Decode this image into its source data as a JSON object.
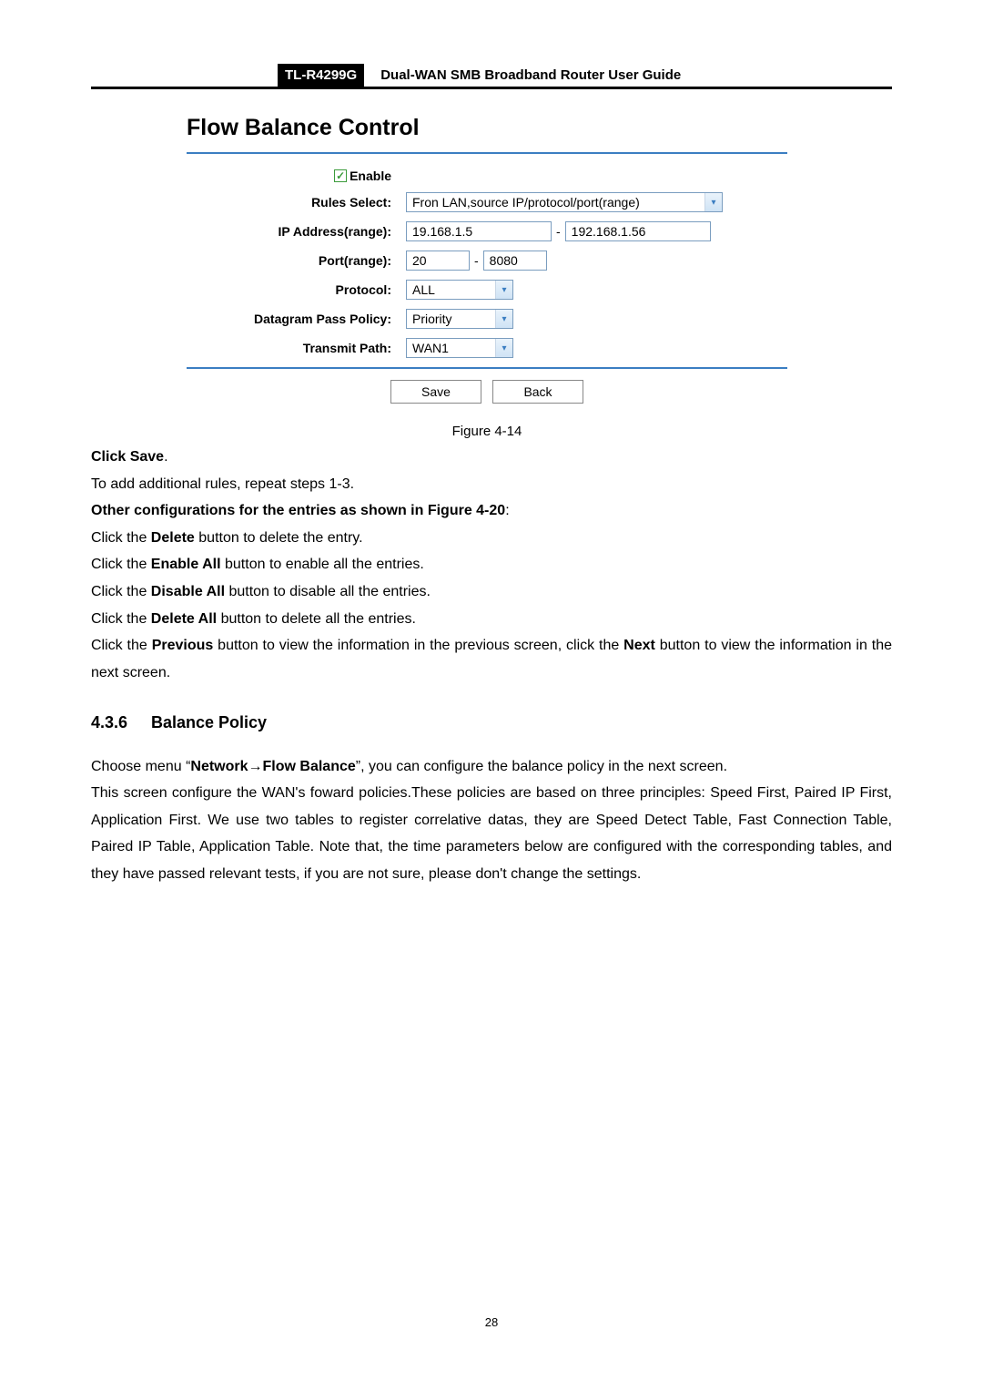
{
  "header": {
    "model": "TL-R4299G",
    "title": "Dual-WAN SMB Broadband Router User Guide"
  },
  "screenshot": {
    "title": "Flow Balance Control",
    "enable_label": "Enable",
    "rows": {
      "rules_select": {
        "label": "Rules Select:",
        "value": "Fron LAN,source IP/protocol/port(range)"
      },
      "ip_range": {
        "label": "IP Address(range):",
        "from": "19.168.1.5",
        "to": "192.168.1.56"
      },
      "port_range": {
        "label": "Port(range):",
        "from": "20",
        "to": "8080"
      },
      "protocol": {
        "label": "Protocol:",
        "value": "ALL"
      },
      "datagram": {
        "label": "Datagram Pass Policy:",
        "value": "Priority"
      },
      "transmit": {
        "label": "Transmit Path:",
        "value": "WAN1"
      }
    },
    "buttons": {
      "save": "Save",
      "back": "Back"
    },
    "caption": "Figure 4-14"
  },
  "body": {
    "click_save": "Click Save",
    "period": ".",
    "add_rules": "To add additional rules, repeat steps 1-3.",
    "other_conf": "Other configurations for the entries as shown in Figure 4-20",
    "colon": ":",
    "delete_pre": "Click the ",
    "delete_b": "Delete",
    "delete_post": " button to delete the entry.",
    "enable_all_pre": "Click the ",
    "enable_all_b": "Enable All",
    "enable_all_post": " button to enable all the entries.",
    "disable_all_pre": "Click the ",
    "disable_all_b": "Disable All",
    "disable_all_post": " button to disable all the entries.",
    "delete_all_pre": "Click the ",
    "delete_all_b": "Delete All",
    "delete_all_post": " button to delete all the entries.",
    "prev_pre": "Click the ",
    "prev_b": "Previous",
    "prev_mid": " button to view the information in the previous screen, click the ",
    "next_b": "Next",
    "next_post": " button to view the information in the next screen.",
    "section_num": "4.3.6",
    "section_title": "Balance Policy",
    "choose_pre": "Choose menu “",
    "choose_b1": "Network",
    "choose_arrow": "→",
    "choose_b2": "Flow Balance",
    "choose_post": "”, you can configure the balance policy in the next screen.",
    "para2": "This screen configure the WAN's foward policies.These policies are based on three principles: Speed First, Paired IP First, Application First. We use two tables to register correlative datas, they are Speed Detect Table, Fast Connection Table, Paired IP Table, Application Table. Note that, the time parameters below are configured with the corresponding tables, and they have passed relevant tests, if you are not sure, please don't change the settings."
  },
  "page_number": "28"
}
